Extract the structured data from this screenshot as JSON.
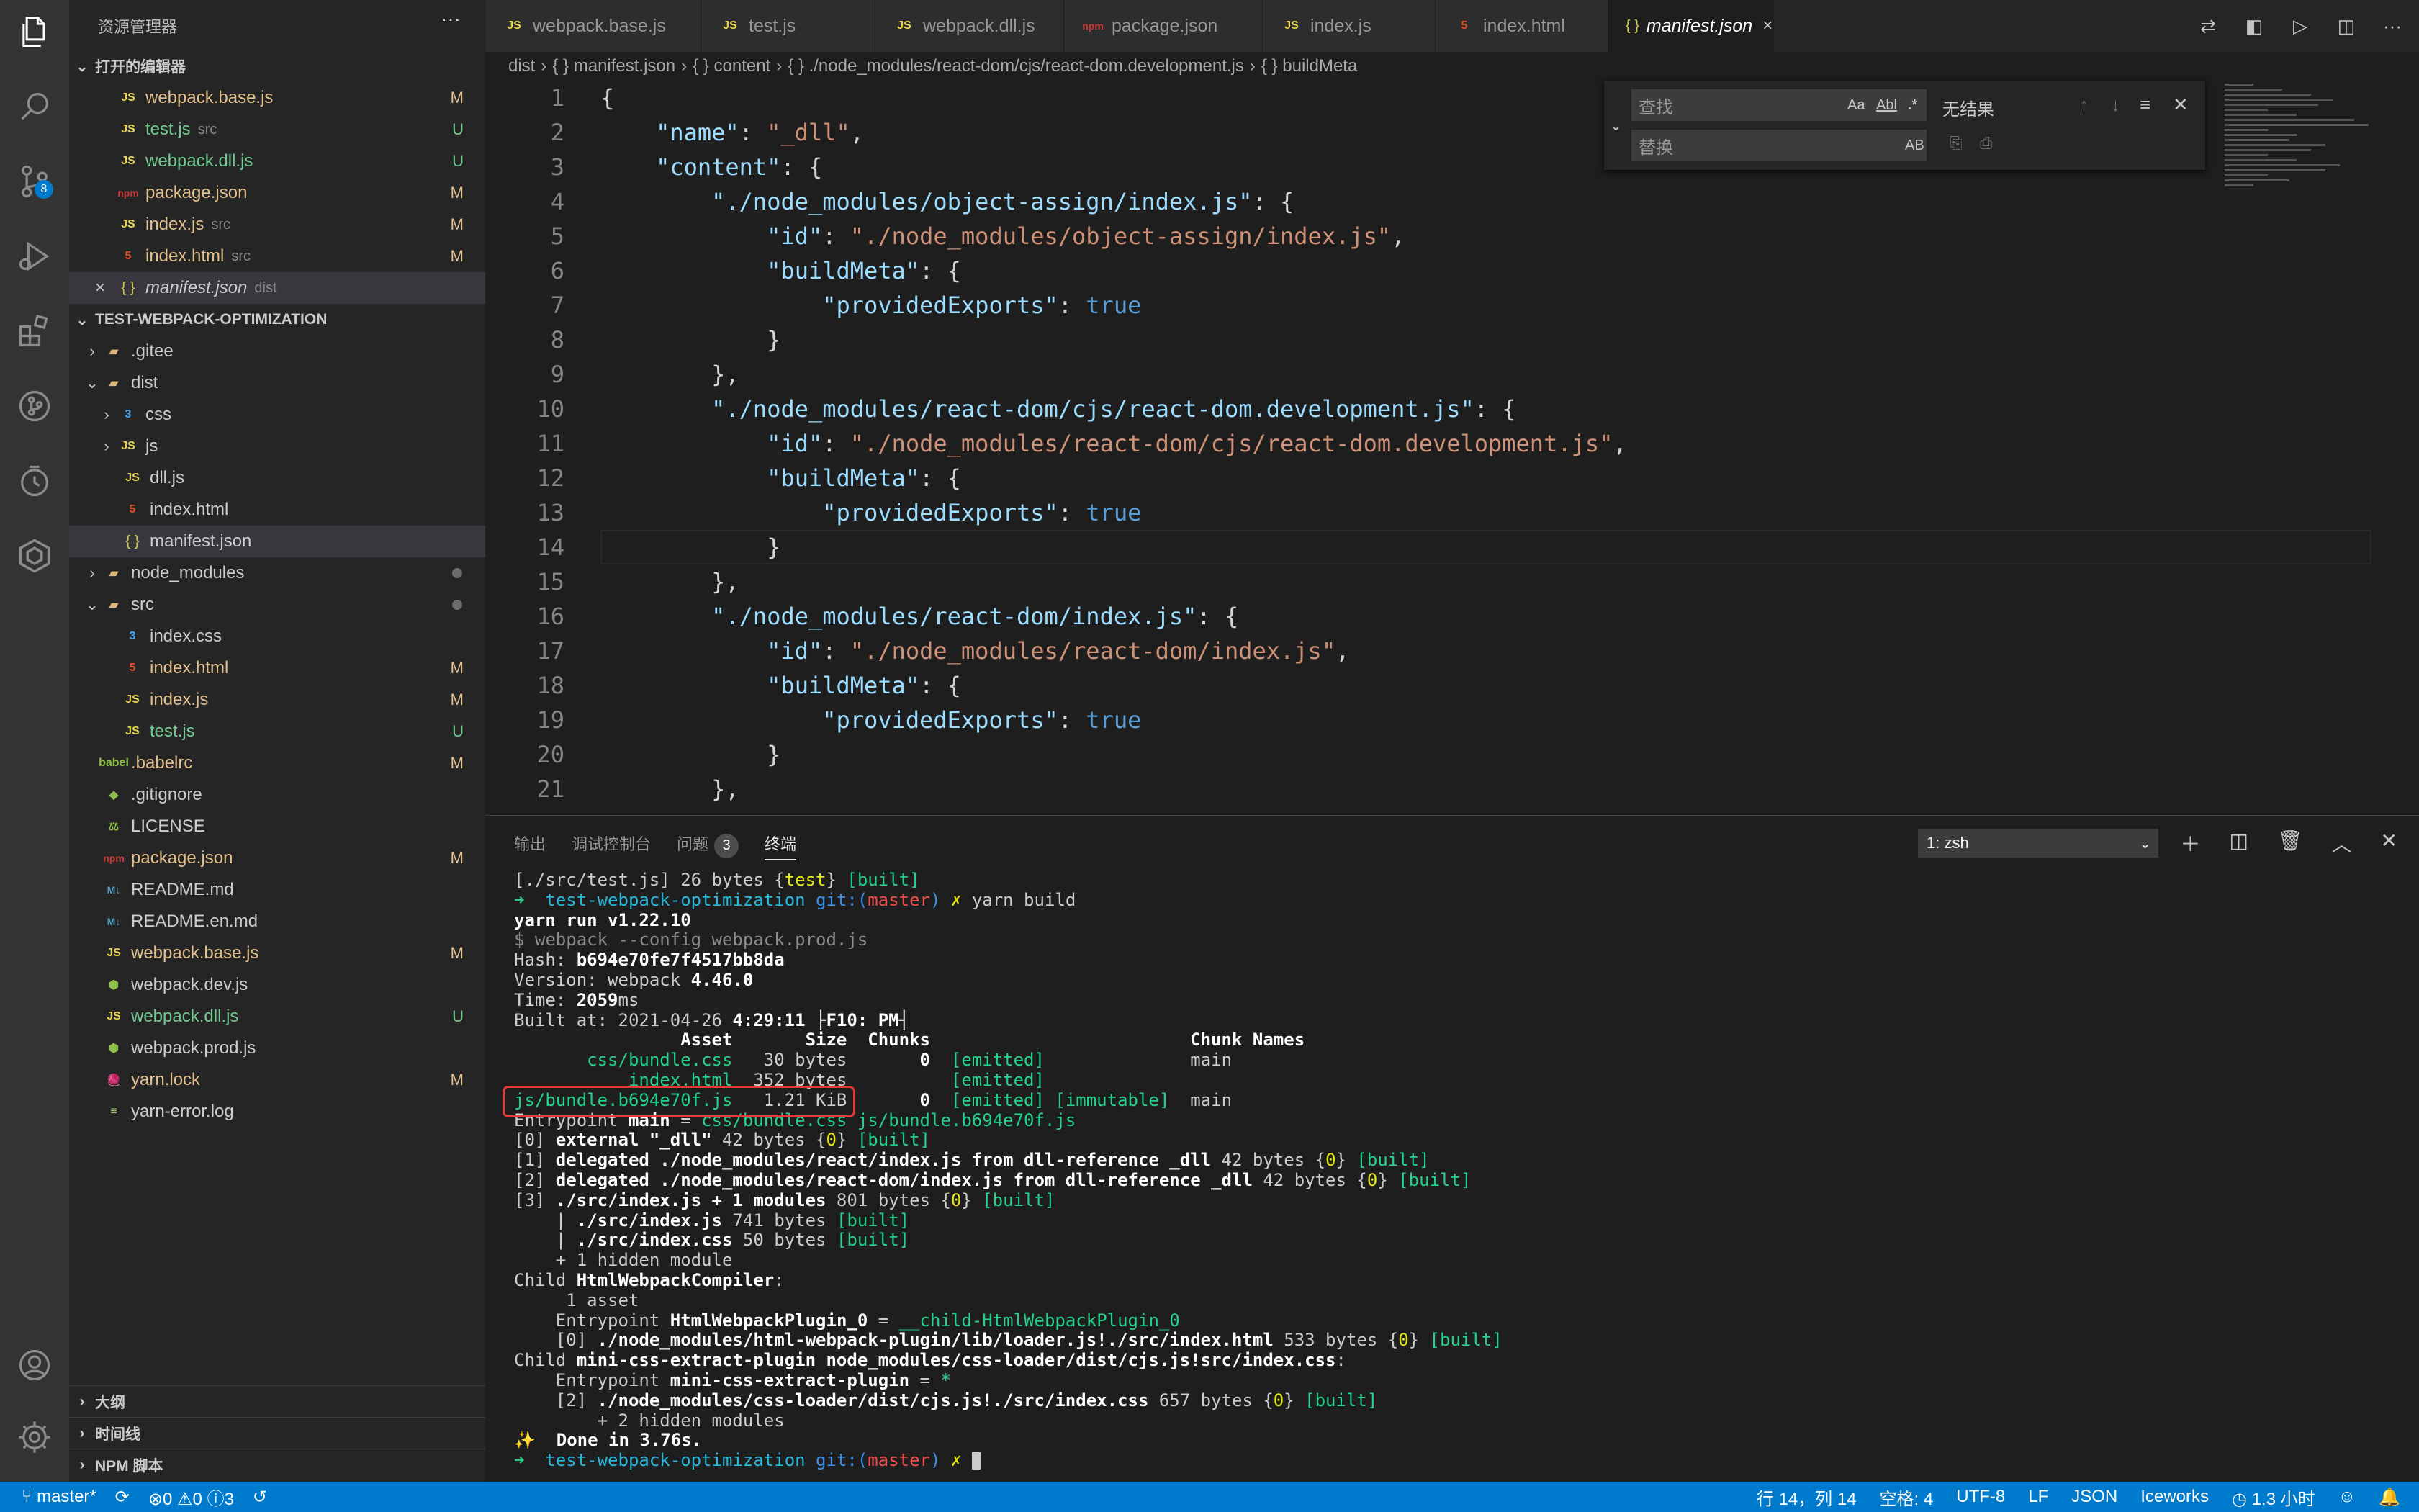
{
  "sidebar": {
    "title": "资源管理器",
    "more": "···",
    "open_editors_header": "打开的编辑器",
    "project_header": "TEST-WEBPACK-OPTIMIZATION",
    "open_editors": [
      {
        "icon": "JS",
        "name": "webpack.base.js",
        "desc": "",
        "status": "M"
      },
      {
        "icon": "JS",
        "name": "test.js",
        "desc": "src",
        "status": "U"
      },
      {
        "icon": "JS",
        "name": "webpack.dll.js",
        "desc": "",
        "status": "U"
      },
      {
        "icon": "pkg",
        "name": "package.json",
        "desc": "",
        "status": "M"
      },
      {
        "icon": "JS",
        "name": "index.js",
        "desc": "src",
        "status": "M"
      },
      {
        "icon": "5",
        "name": "index.html",
        "desc": "src",
        "status": "M"
      },
      {
        "icon": "{ }",
        "name": "manifest.json",
        "desc": "dist",
        "status": "",
        "close": "×"
      }
    ],
    "tree": [
      {
        "twist": "›",
        "icon": "▬",
        "name": ".gitee"
      },
      {
        "twist": "⌄",
        "icon": "▬",
        "name": "dist"
      },
      {
        "twist": "›",
        "icon": "3",
        "name": "css"
      },
      {
        "twist": "›",
        "icon": "JS",
        "name": "js"
      },
      {
        "icon": "JS",
        "name": "dll.js"
      },
      {
        "icon": "5",
        "name": "index.html"
      },
      {
        "icon": "{ }",
        "name": "manifest.json"
      },
      {
        "twist": "›",
        "icon": "▬",
        "name": "node_modules"
      },
      {
        "twist": "⌄",
        "icon": "▬",
        "name": "src"
      },
      {
        "icon": "3",
        "name": "index.css"
      },
      {
        "icon": "5",
        "name": "index.html",
        "status": "M"
      },
      {
        "icon": "JS",
        "name": "index.js",
        "status": "M"
      },
      {
        "icon": "JS",
        "name": "test.js",
        "status": "U"
      },
      {
        "icon": "babel",
        "name": ".babelrc",
        "status": "M"
      },
      {
        "icon": "◆",
        "name": ".gitignore"
      },
      {
        "icon": "⚖",
        "name": "LICENSE"
      },
      {
        "icon": "pkg",
        "name": "package.json",
        "status": "M"
      },
      {
        "icon": "M↓",
        "name": "README.md"
      },
      {
        "icon": "M↓",
        "name": "README.en.md"
      },
      {
        "icon": "JS",
        "name": "webpack.base.js",
        "status": "M"
      },
      {
        "icon": "⬢",
        "name": "webpack.dev.js"
      },
      {
        "icon": "JS",
        "name": "webpack.dll.js",
        "status": "U"
      },
      {
        "icon": "⬢",
        "name": "webpack.prod.js"
      },
      {
        "icon": "🧶",
        "name": "yarn.lock",
        "status": "M"
      },
      {
        "icon": "≡",
        "name": "yarn-error.log"
      }
    ],
    "bottom_sections": [
      "大纲",
      "时间线",
      "NPM 脚本"
    ]
  },
  "activity": {
    "scm_badge": "8"
  },
  "tabs": [
    {
      "icon": "JS",
      "label": "webpack.base.js"
    },
    {
      "icon": "JS",
      "label": "test.js"
    },
    {
      "icon": "JS",
      "label": "webpack.dll.js"
    },
    {
      "icon": "pkg",
      "label": "package.json"
    },
    {
      "icon": "JS",
      "label": "index.js"
    },
    {
      "icon": "5",
      "label": "index.html"
    },
    {
      "icon": "{ }",
      "label": "manifest.json",
      "close": "×"
    }
  ],
  "breadcrumb": [
    "dist",
    "{ } manifest.json",
    "{ } content",
    "{ } ./node_modules/react-dom/cjs/react-dom.development.js",
    "{ } buildMeta"
  ],
  "code_lines": [
    {
      "n": "1",
      "t": "{"
    },
    {
      "n": "2",
      "t": "    \"name\": \"_dll\","
    },
    {
      "n": "3",
      "t": "    \"content\": {"
    },
    {
      "n": "4",
      "t": "        \"./node_modules/object-assign/index.js\": {"
    },
    {
      "n": "5",
      "t": "            \"id\": \"./node_modules/object-assign/index.js\","
    },
    {
      "n": "6",
      "t": "            \"buildMeta\": {"
    },
    {
      "n": "7",
      "t": "                \"providedExports\": true"
    },
    {
      "n": "8",
      "t": "            }"
    },
    {
      "n": "9",
      "t": "        },"
    },
    {
      "n": "10",
      "t": "        \"./node_modules/react-dom/cjs/react-dom.development.js\": {"
    },
    {
      "n": "11",
      "t": "            \"id\": \"./node_modules/react-dom/cjs/react-dom.development.js\","
    },
    {
      "n": "12",
      "t": "            \"buildMeta\": {"
    },
    {
      "n": "13",
      "t": "                \"providedExports\": true"
    },
    {
      "n": "14",
      "t": "            }"
    },
    {
      "n": "15",
      "t": "        },"
    },
    {
      "n": "16",
      "t": "        \"./node_modules/react-dom/index.js\": {"
    },
    {
      "n": "17",
      "t": "            \"id\": \"./node_modules/react-dom/index.js\","
    },
    {
      "n": "18",
      "t": "            \"buildMeta\": {"
    },
    {
      "n": "19",
      "t": "                \"providedExports\": true"
    },
    {
      "n": "20",
      "t": "            }"
    },
    {
      "n": "21",
      "t": "        },"
    }
  ],
  "find_widget": {
    "find_placeholder": "查找",
    "replace_placeholder": "替换",
    "opt_case": "Aa",
    "opt_word": "Abl",
    "opt_regex": ".*",
    "opt_preserve": "AB",
    "result": "无结果"
  },
  "panel": {
    "tabs": [
      "输出",
      "调试控制台",
      "问题",
      "终端"
    ],
    "problems_count": "3",
    "terminal_select": "1: zsh"
  },
  "terminal": [
    [
      {
        "t": "[./src/test.js] 26 bytes {"
      },
      {
        "t": "test",
        "c": "t-y"
      },
      {
        "t": "} "
      },
      {
        "t": "[built]",
        "c": "t-g"
      }
    ],
    [
      {
        "t": "➜  ",
        "c": "t-g"
      },
      {
        "t": "test-webpack-optimization ",
        "c": "t-c"
      },
      {
        "t": "git:(",
        "c": "t-b"
      },
      {
        "t": "master",
        "c": "t-r"
      },
      {
        "t": ")",
        "c": "t-b"
      },
      {
        "t": " ✗ ",
        "c": "t-y"
      },
      {
        "t": "yarn build"
      }
    ],
    [
      {
        "t": "yarn run v1.22.10",
        "c": "t-w"
      }
    ],
    [
      {
        "t": "$ webpack --config webpack.prod.js",
        "c": "t-gy"
      }
    ],
    [
      {
        "t": "Hash: "
      },
      {
        "t": "b694e70fe7f4517bb8da",
        "c": "t-w"
      }
    ],
    [
      {
        "t": "Version: webpack "
      },
      {
        "t": "4.46.0",
        "c": "t-w"
      }
    ],
    [
      {
        "t": "Time: "
      },
      {
        "t": "2059",
        "c": "t-w"
      },
      {
        "t": "ms"
      }
    ],
    [
      {
        "t": "Built at: 2021-04-26 "
      },
      {
        "t": "4:29:11 ├F10: PM┤",
        "c": "t-w"
      }
    ],
    [
      {
        "t": "                Asset       Size  Chunks                         Chunk Names",
        "c": "t-w"
      }
    ],
    [
      {
        "t": "       "
      },
      {
        "t": "css/bundle.css",
        "c": "t-g"
      },
      {
        "t": "   30 bytes       "
      },
      {
        "t": "0",
        "c": "t-w"
      },
      {
        "t": "  "
      },
      {
        "t": "[emitted]",
        "c": "t-g"
      },
      {
        "t": "              main"
      }
    ],
    [
      {
        "t": "           "
      },
      {
        "t": "index.html",
        "c": "t-g"
      },
      {
        "t": "  352 bytes          "
      },
      {
        "t": "[emitted]",
        "c": "t-g"
      }
    ],
    [
      {
        "t": "js/bundle.b694e70f.js",
        "c": "t-g"
      },
      {
        "t": "   1.21 KiB       "
      },
      {
        "t": "0",
        "c": "t-w"
      },
      {
        "t": "  "
      },
      {
        "t": "[emitted] [immutable]",
        "c": "t-g"
      },
      {
        "t": "  main"
      }
    ],
    [
      {
        "t": "Entrypoint "
      },
      {
        "t": "main",
        "c": "t-w"
      },
      {
        "t": " = "
      },
      {
        "t": "css/bundle.css js/bundle.b694e70f.js",
        "c": "t-g"
      }
    ],
    [
      {
        "t": "[0] "
      },
      {
        "t": "external \"_dll\"",
        "c": "t-w"
      },
      {
        "t": " 42 bytes {"
      },
      {
        "t": "0",
        "c": "t-y"
      },
      {
        "t": "} "
      },
      {
        "t": "[built]",
        "c": "t-g"
      }
    ],
    [
      {
        "t": "[1] "
      },
      {
        "t": "delegated ./node_modules/react/index.js from dll-reference _dll",
        "c": "t-w"
      },
      {
        "t": " 42 bytes {"
      },
      {
        "t": "0",
        "c": "t-y"
      },
      {
        "t": "} "
      },
      {
        "t": "[built]",
        "c": "t-g"
      }
    ],
    [
      {
        "t": "[2] "
      },
      {
        "t": "delegated ./node_modules/react-dom/index.js from dll-reference _dll",
        "c": "t-w"
      },
      {
        "t": " 42 bytes {"
      },
      {
        "t": "0",
        "c": "t-y"
      },
      {
        "t": "} "
      },
      {
        "t": "[built]",
        "c": "t-g"
      }
    ],
    [
      {
        "t": "[3] "
      },
      {
        "t": "./src/index.js + 1 modules",
        "c": "t-w"
      },
      {
        "t": " 801 bytes {"
      },
      {
        "t": "0",
        "c": "t-y"
      },
      {
        "t": "} "
      },
      {
        "t": "[built]",
        "c": "t-g"
      }
    ],
    [
      {
        "t": "    | "
      },
      {
        "t": "./src/index.js",
        "c": "t-w"
      },
      {
        "t": " 741 bytes "
      },
      {
        "t": "[built]",
        "c": "t-g"
      }
    ],
    [
      {
        "t": "    | "
      },
      {
        "t": "./src/index.css",
        "c": "t-w"
      },
      {
        "t": " 50 bytes "
      },
      {
        "t": "[built]",
        "c": "t-g"
      }
    ],
    [
      {
        "t": "    + 1 hidden module"
      }
    ],
    [
      {
        "t": "Child "
      },
      {
        "t": "HtmlWebpackCompiler",
        "c": "t-w"
      },
      {
        "t": ":"
      }
    ],
    [
      {
        "t": "     1 asset"
      }
    ],
    [
      {
        "t": "    Entrypoint "
      },
      {
        "t": "HtmlWebpackPlugin_0",
        "c": "t-w"
      },
      {
        "t": " = "
      },
      {
        "t": "__child-HtmlWebpackPlugin_0",
        "c": "t-g"
      }
    ],
    [
      {
        "t": "    [0] "
      },
      {
        "t": "./node_modules/html-webpack-plugin/lib/loader.js!./src/index.html",
        "c": "t-w"
      },
      {
        "t": " 533 bytes {"
      },
      {
        "t": "0",
        "c": "t-y"
      },
      {
        "t": "} "
      },
      {
        "t": "[built]",
        "c": "t-g"
      }
    ],
    [
      {
        "t": "Child "
      },
      {
        "t": "mini-css-extract-plugin node_modules/css-loader/dist/cjs.js!src/index.css",
        "c": "t-w"
      },
      {
        "t": ":"
      }
    ],
    [
      {
        "t": "    Entrypoint "
      },
      {
        "t": "mini-css-extract-plugin",
        "c": "t-w"
      },
      {
        "t": " = "
      },
      {
        "t": "*",
        "c": "t-g"
      }
    ],
    [
      {
        "t": "    [2] "
      },
      {
        "t": "./node_modules/css-loader/dist/cjs.js!./src/index.css",
        "c": "t-w"
      },
      {
        "t": " 657 bytes {"
      },
      {
        "t": "0",
        "c": "t-y"
      },
      {
        "t": "} "
      },
      {
        "t": "[built]",
        "c": "t-g"
      }
    ],
    [
      {
        "t": "        + 2 hidden modules"
      }
    ],
    [
      {
        "t": "✨  Done in 3.76s.",
        "c": "t-w"
      }
    ],
    [
      {
        "t": "➜  ",
        "c": "t-g"
      },
      {
        "t": "test-webpack-optimization ",
        "c": "t-c"
      },
      {
        "t": "git:(",
        "c": "t-b"
      },
      {
        "t": "master",
        "c": "t-r"
      },
      {
        "t": ")",
        "c": "t-b"
      },
      {
        "t": " ✗ ",
        "c": "t-y"
      }
    ]
  ],
  "status": {
    "branch": "master*",
    "errors": "0",
    "warnings": "0",
    "info": "3",
    "position": "行 14，列 14",
    "spaces": "空格: 4",
    "encoding": "UTF-8",
    "eol": "LF",
    "language": "JSON",
    "iceworks": "Iceworks",
    "time": "1.3 小时"
  }
}
